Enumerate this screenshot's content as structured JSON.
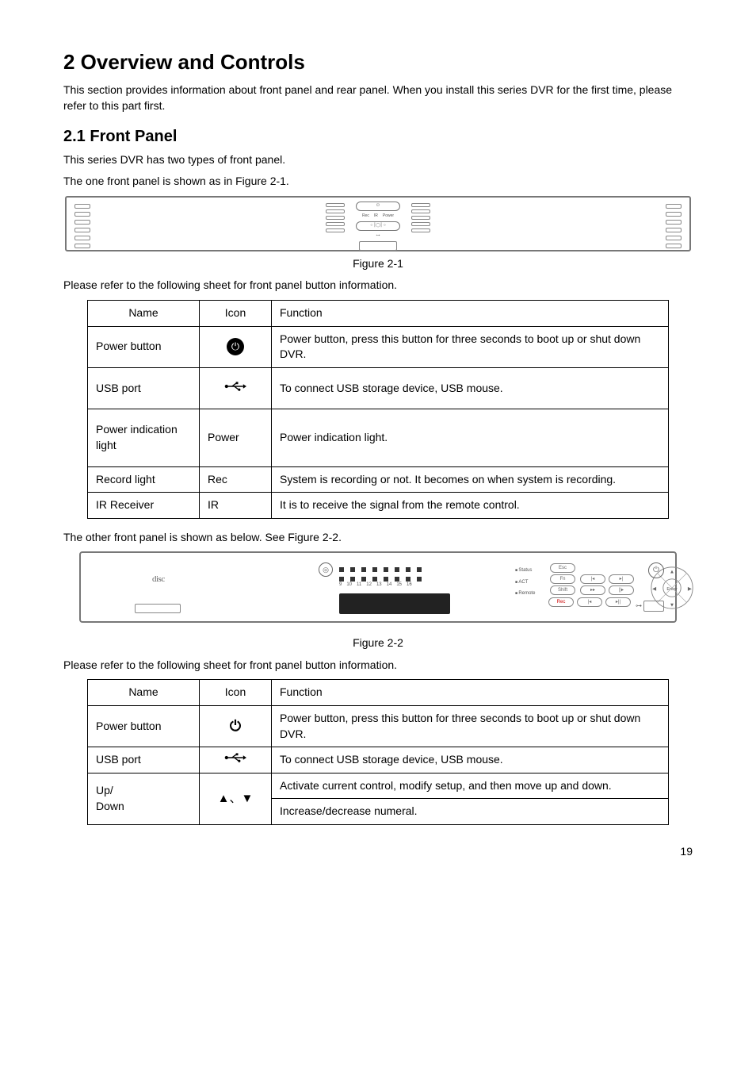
{
  "headings": {
    "h1": "2  Overview and Controls",
    "h2": "2.1  Front Panel"
  },
  "paras": {
    "intro1": "This section provides information about front panel and rear panel. When you install this series DVR for the first time, please refer to this part first.",
    "fp_intro1": "This series DVR has two types of front panel.",
    "fp_intro2": "The one front panel is shown as in Figure 2-1.",
    "fig1": "Figure 2-1",
    "sheet1": "Please refer to the following sheet for front panel button information.",
    "other_panel": "The other front panel is shown as below. See Figure 2-2.",
    "fig2": "Figure 2-2",
    "sheet2": "Please refer to the following sheet for front panel button information."
  },
  "table_headers": {
    "name": "Name",
    "icon": "Icon",
    "function": "Function"
  },
  "table1": [
    {
      "name": "Power button",
      "icon": "power-filled",
      "func": "Power button, press this button for three seconds to boot up or shut down DVR."
    },
    {
      "name": "USB port",
      "icon": "usb",
      "func": "To connect USB storage device, USB mouse."
    },
    {
      "name": "Power indication light",
      "icon_text": "Power",
      "func": "Power indication light."
    },
    {
      "name": "Record light",
      "icon_text": "Rec",
      "func": "System is recording or not. It becomes on when system is recording."
    },
    {
      "name": "IR Receiver",
      "icon_text": "IR",
      "func": "It is to receive the signal from the remote control."
    }
  ],
  "table2": [
    {
      "name": "Power button",
      "icon": "power-outline",
      "func": "Power button, press this button for three seconds to boot up or shut down DVR."
    },
    {
      "name": "USB port",
      "icon": "usb",
      "func": "To connect USB storage device, USB mouse."
    },
    {
      "name": "Up/\nDown",
      "icon": "arrows",
      "func1": "Activate current control, modify setup, and then move up and down.",
      "func2": "Increase/decrease numeral."
    }
  ],
  "panel2_labels": {
    "disc": "disc",
    "side": [
      "Status",
      "ACT",
      "Remote"
    ],
    "btns": {
      "esc": "Esc",
      "fn": "Fn",
      "shift": "Shift",
      "rec": "Rec",
      "enter": "Enter"
    }
  },
  "page_number": "19",
  "chart_data": null
}
